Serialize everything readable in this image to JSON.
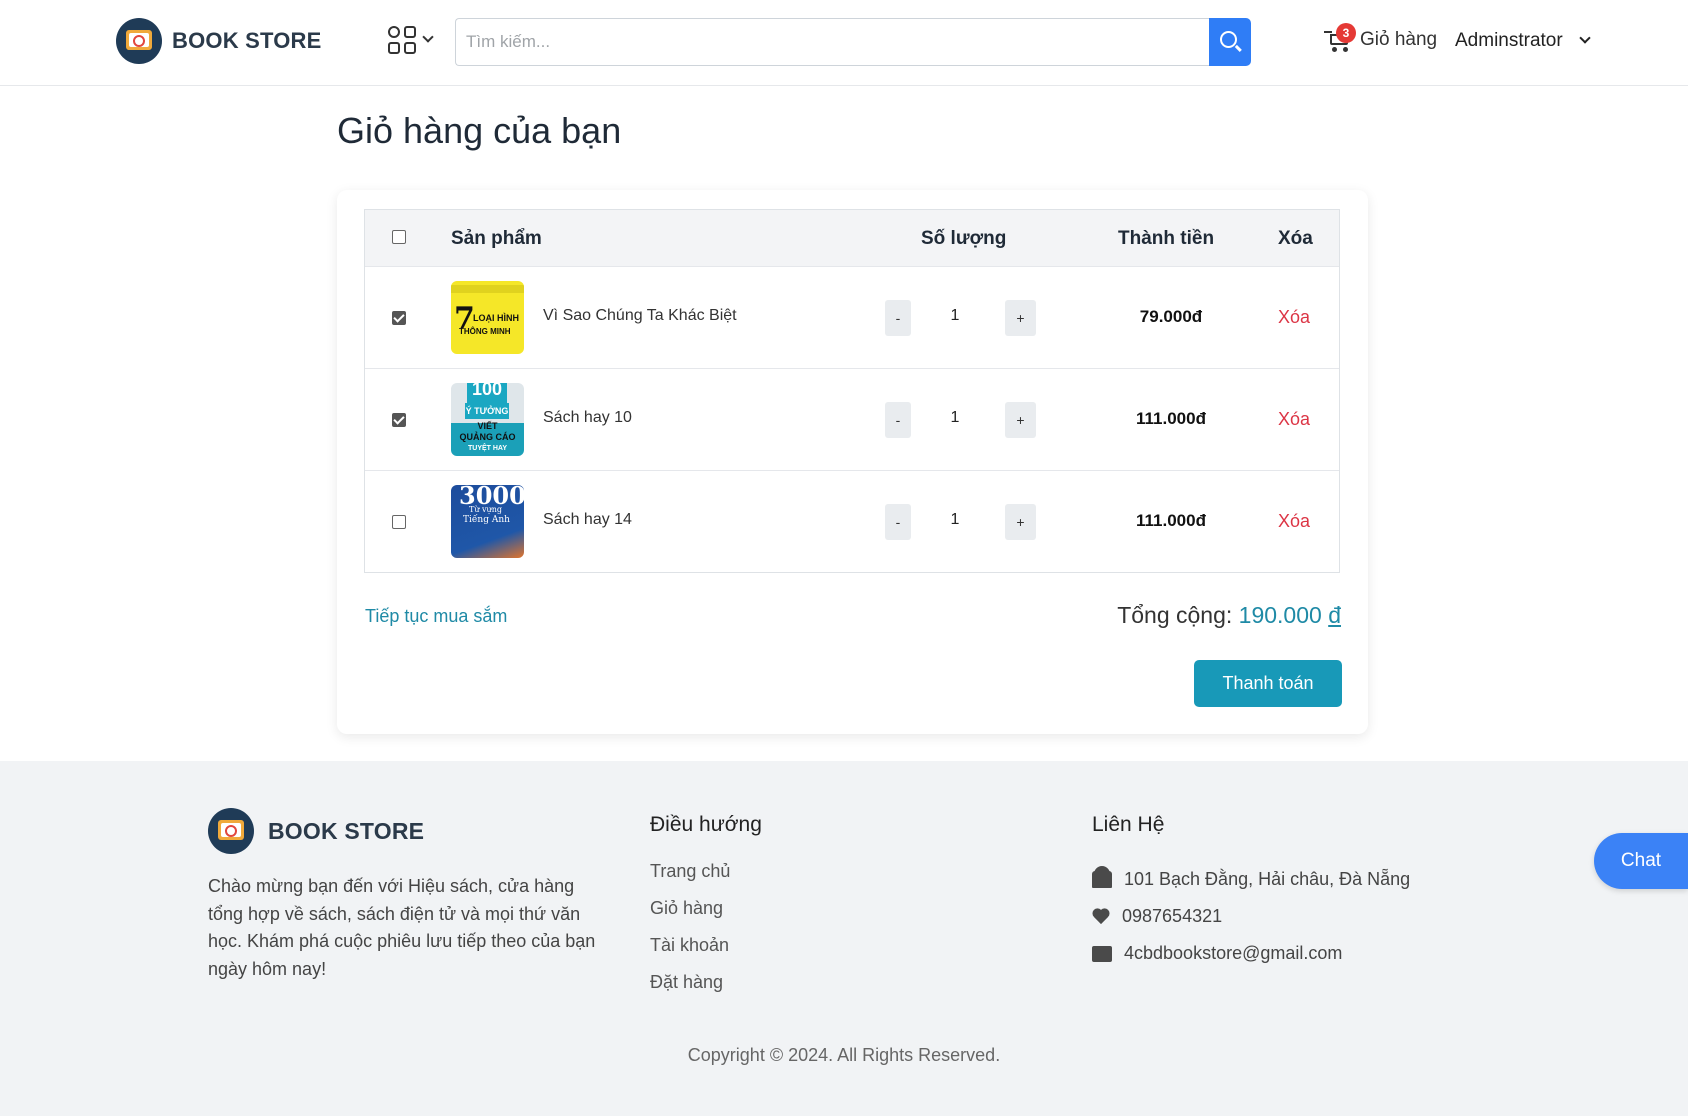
{
  "header": {
    "brand": "BOOK STORE",
    "search_placeholder": "Tìm kiếm...",
    "cart_label": "Giỏ hàng",
    "cart_count": "3",
    "user_name": "Adminstrator"
  },
  "page_title": "Giỏ hàng của bạn",
  "cart": {
    "columns": {
      "product": "Sản phẩm",
      "quantity": "Số lượng",
      "total": "Thành tiền",
      "delete": "Xóa"
    },
    "items": [
      {
        "name": "Vì Sao Chúng Ta Khác Biệt",
        "qty": "1",
        "price": "79.000đ",
        "checked": true,
        "delete_label": "Xóa",
        "minus": "-",
        "plus": "+"
      },
      {
        "name": "Sách hay 10",
        "qty": "1",
        "price": "111.000đ",
        "checked": true,
        "delete_label": "Xóa",
        "minus": "-",
        "plus": "+"
      },
      {
        "name": "Sách hay 14",
        "qty": "1",
        "price": "111.000đ",
        "checked": false,
        "delete_label": "Xóa",
        "minus": "-",
        "plus": "+"
      }
    ],
    "covers": {
      "item1": {
        "big": "7",
        "line1": "LOẠI HÌNH",
        "line2": "THÔNG MINH"
      },
      "item2": {
        "top": "100",
        "mid": "Ý TƯỞNG",
        "line1": "VIẾT",
        "line2": "QUẢNG CÁO",
        "line3": "TUYỆT HAY"
      },
      "item3": {
        "num": "3000",
        "line1": "Từ vựng",
        "line2": "Tiếng Anh"
      }
    },
    "continue_label": "Tiếp tục mua sắm",
    "total_label": "Tổng cộng:",
    "total_amount": "190.000",
    "total_currency": "đ",
    "pay_label": "Thanh toán"
  },
  "footer": {
    "brand": "BOOK STORE",
    "description": "Chào mừng bạn đến với Hiệu sách, cửa hàng tổng hợp về sách, sách điện tử và mọi thứ văn học. Khám phá cuộc phiêu lưu tiếp theo của bạn ngày hôm nay!",
    "nav_title": "Điều hướng",
    "nav_links": [
      "Trang chủ",
      "Giỏ hàng",
      "Tài khoản",
      "Đặt hàng"
    ],
    "contact_title": "Liên Hệ",
    "address": "101 Bạch Đằng, Hải châu, Đà Nẵng",
    "phone": "0987654321",
    "email": "4cbdbookstore@gmail.com",
    "copyright": "Copyright © 2024. All Rights Reserved."
  },
  "chat_label": "Chat",
  "colors": {
    "accent": "#1899b8",
    "search_button": "#2f7df6",
    "delete": "#dc3545",
    "badge": "#e53935",
    "chat": "#3b82f6"
  }
}
